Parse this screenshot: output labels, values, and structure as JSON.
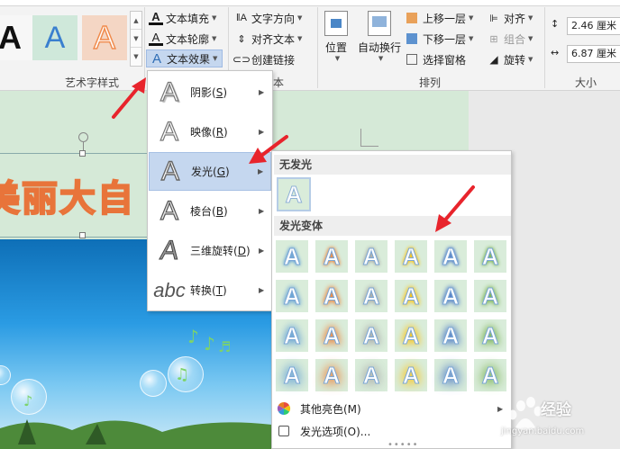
{
  "ribbon": {
    "wordart_styles": {
      "label": "艺术字样式",
      "swatch_glyph": "A",
      "text_fill": "文本填充",
      "text_outline": "文本轮廓",
      "text_effects": "文本效果"
    },
    "text_group": {
      "label": "本",
      "text_direction": "文字方向",
      "align_text": "对齐文本",
      "create_link": "创建链接"
    },
    "arrange": {
      "label": "排列",
      "position": "位置",
      "wrap_text": "自动换行",
      "bring_forward": "上移一层",
      "send_backward": "下移一层",
      "selection_pane": "选择窗格",
      "align": "对齐",
      "group": "组合",
      "rotate": "旋转"
    },
    "size": {
      "label": "大小",
      "height": "2.46 厘米",
      "width": "6.87 厘米"
    }
  },
  "document": {
    "wordart_text": "美丽大自"
  },
  "effects_menu": {
    "items": [
      {
        "glyph": "A",
        "label": "阴影",
        "key": "S"
      },
      {
        "glyph": "A",
        "label": "映像",
        "key": "R"
      },
      {
        "glyph": "A",
        "label": "发光",
        "key": "G"
      },
      {
        "glyph": "A",
        "label": "棱台",
        "key": "B"
      },
      {
        "glyph": "A",
        "label": "三维旋转",
        "key": "D"
      },
      {
        "glyph": "abc",
        "label": "转换",
        "key": "T"
      }
    ]
  },
  "glow_menu": {
    "no_glow_header": "无发光",
    "variants_header": "发光变体",
    "cell_glyph": "A",
    "glow_colors": [
      "#5b9bd5",
      "#ed7d31",
      "#a5a5a5",
      "#ffc000",
      "#4472c4",
      "#70ad47"
    ],
    "more_colors": "其他亮色(M)",
    "glow_options": "发光选项(O)..."
  },
  "watermark": {
    "brand": "经验",
    "url": "jingyan.baidu.com"
  }
}
